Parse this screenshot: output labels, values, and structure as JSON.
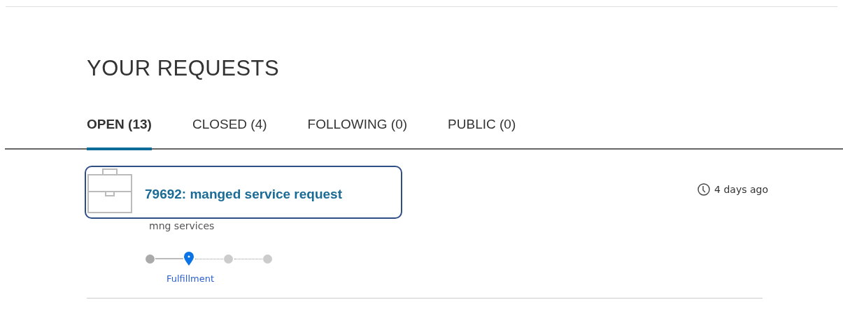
{
  "page_title": "YOUR REQUESTS",
  "tabs": [
    {
      "label": "OPEN (13)",
      "selected": true
    },
    {
      "label": "CLOSED (4)",
      "selected": false
    },
    {
      "label": "FOLLOWING (0)",
      "selected": false
    },
    {
      "label": "PUBLIC (0)",
      "selected": false
    }
  ],
  "requests": [
    {
      "title": "79692: manged service request",
      "highlighted": true,
      "subtitle": "mng services",
      "time": "4 days ago",
      "steps": [
        {
          "kind": "done"
        },
        {
          "kind": "current",
          "label": "Fulfillment"
        },
        {
          "kind": "pending"
        },
        {
          "kind": "pending"
        }
      ]
    }
  ]
}
